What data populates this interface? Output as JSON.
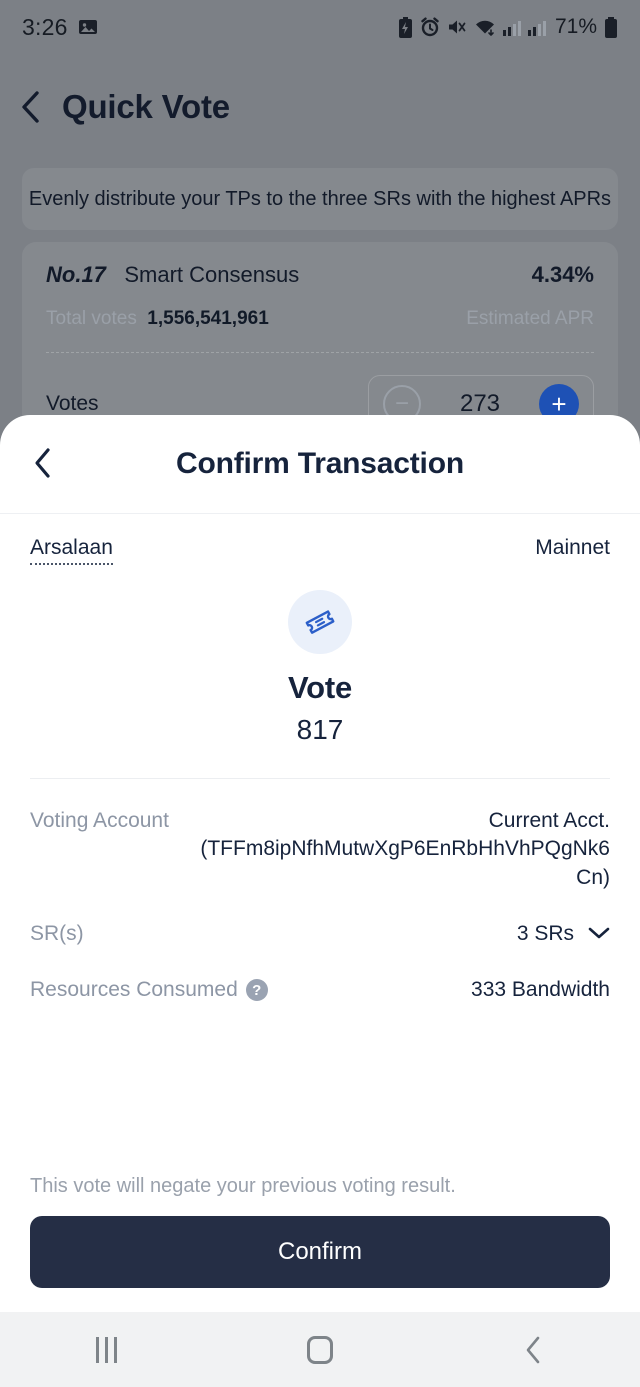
{
  "status_bar": {
    "time": "3:26",
    "battery_percent": "71%",
    "icons": [
      "image-icon",
      "battery-saver-icon",
      "alarm-icon",
      "mute-icon",
      "wifi-icon",
      "signal-icon",
      "signal-icon",
      "battery-icon"
    ]
  },
  "background_page": {
    "title": "Quick Vote",
    "back_icon": "chevron-left-icon",
    "hint": "Evenly distribute your TPs to the three SRs with the highest APRs",
    "sr_card": {
      "rank": "No.17",
      "name": "Smart Consensus",
      "apr": "4.34%",
      "total_votes_label": "Total votes",
      "total_votes_value": "1,556,541,961",
      "apr_caption": "Estimated APR",
      "votes_label": "Votes",
      "votes_value": "273",
      "minus_label": "−",
      "plus_label": "+"
    }
  },
  "sheet": {
    "back_icon": "chevron-left-icon",
    "title": "Confirm Transaction",
    "wallet_name": "Arsalaan",
    "network": "Mainnet",
    "type_icon": "vote-ticket-icon",
    "action_label": "Vote",
    "amount": "817",
    "details": [
      {
        "label": "Voting Account",
        "value": "Current Acct. (TFFm8ipNfhMutwXgP6EnRbHhVhPQgNk6Cn)"
      },
      {
        "label": "SR(s)",
        "value": "3 SRs",
        "chevron": "chevron-down-icon"
      },
      {
        "label": "Resources Consumed",
        "help_icon": "question-mark-icon",
        "help_glyph": "?",
        "value": "333 Bandwidth"
      }
    ],
    "warning": "This vote will negate your previous voting result.",
    "confirm_label": "Confirm"
  },
  "android_nav": {
    "recents": "recents-icon",
    "home": "home-icon",
    "back": "back-icon"
  },
  "colors": {
    "accent_blue": "#1e51b5",
    "navy": "#16233c",
    "button": "#252e45",
    "muted": "#8d96a5"
  }
}
